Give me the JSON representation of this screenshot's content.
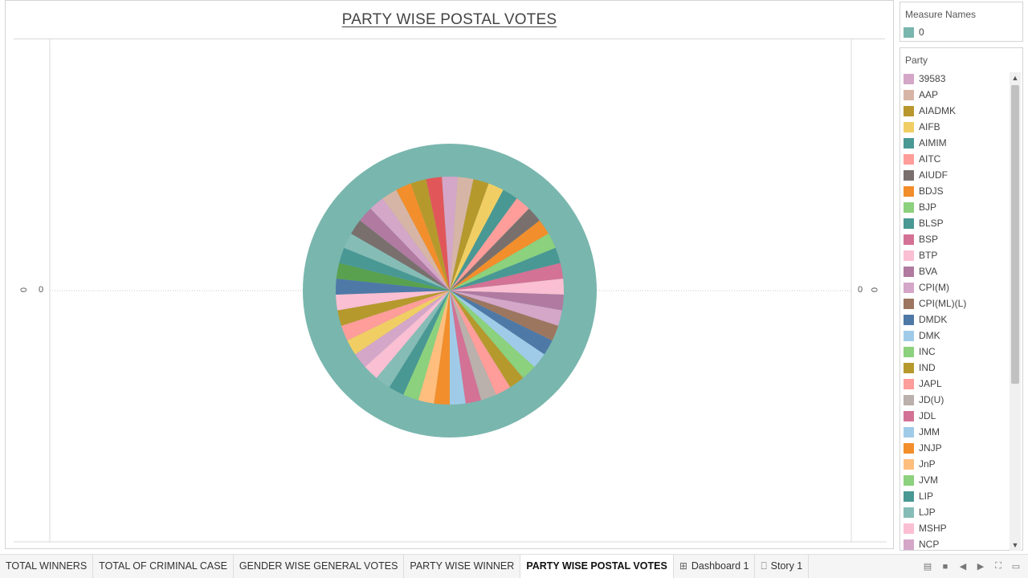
{
  "chart_data": {
    "type": "pie",
    "title": "PARTY WISE POSTAL VOTES",
    "axis_value_label": "0",
    "measure_legend_title": "Measure Names",
    "measure_names": [
      {
        "label": "0",
        "color": "#79b6ae"
      }
    ],
    "party_legend_title": "Party",
    "parties": [
      {
        "label": "39583",
        "color": "#d4a6c8"
      },
      {
        "label": "AAP",
        "color": "#d7b5a6"
      },
      {
        "label": "AIADMK",
        "color": "#b9972e"
      },
      {
        "label": "AIFB",
        "color": "#f1ce63"
      },
      {
        "label": "AIMIM",
        "color": "#499894"
      },
      {
        "label": "AITC",
        "color": "#ff9d9a"
      },
      {
        "label": "AIUDF",
        "color": "#79706e"
      },
      {
        "label": "BDJS",
        "color": "#f28e2b"
      },
      {
        "label": "BJP",
        "color": "#8cd17d"
      },
      {
        "label": "BLSP",
        "color": "#499894"
      },
      {
        "label": "BSP",
        "color": "#d37295"
      },
      {
        "label": "BTP",
        "color": "#fabfd2"
      },
      {
        "label": "BVA",
        "color": "#b07aa1"
      },
      {
        "label": "CPI(M)",
        "color": "#d4a6c8"
      },
      {
        "label": "CPI(ML)(L)",
        "color": "#9d7660"
      },
      {
        "label": "DMDK",
        "color": "#4e79a7"
      },
      {
        "label": "DMK",
        "color": "#a0cbe8"
      },
      {
        "label": "INC",
        "color": "#8cd17d"
      },
      {
        "label": "IND",
        "color": "#b6992d"
      },
      {
        "label": "JAPL",
        "color": "#ff9d9a"
      },
      {
        "label": "JD(U)",
        "color": "#bab0ac"
      },
      {
        "label": "JDL",
        "color": "#d37295"
      },
      {
        "label": "JMM",
        "color": "#a0cbe8"
      },
      {
        "label": "JNJP",
        "color": "#f28e2b"
      },
      {
        "label": "JnP",
        "color": "#ffbe7d"
      },
      {
        "label": "JVM",
        "color": "#8cd17d"
      },
      {
        "label": "LIP",
        "color": "#499894"
      },
      {
        "label": "LJP",
        "color": "#86bcb6"
      },
      {
        "label": "MSHP",
        "color": "#fabfd2"
      },
      {
        "label": "NCP",
        "color": "#d4a6c8"
      }
    ],
    "slice_colors": [
      "#d4a6c8",
      "#d7b5a6",
      "#b6992d",
      "#f1ce63",
      "#499894",
      "#ff9d9a",
      "#79706e",
      "#f28e2b",
      "#8cd17d",
      "#499894",
      "#d37295",
      "#fabfd2",
      "#b07aa1",
      "#d4a6c8",
      "#9d7660",
      "#4e79a7",
      "#a0cbe8",
      "#8cd17d",
      "#b6992d",
      "#ff9d9a",
      "#bab0ac",
      "#d37295",
      "#a0cbe8",
      "#f28e2b",
      "#ffbe7d",
      "#8cd17d",
      "#499894",
      "#86bcb6",
      "#fabfd2",
      "#d4a6c8",
      "#f1ce63",
      "#ff9d9a",
      "#b6992d",
      "#fabfd2",
      "#4e79a7",
      "#59a14f",
      "#499894",
      "#86bcb6",
      "#79706e",
      "#b07aa1",
      "#d4a6c8",
      "#d7b5a6",
      "#f28e2b",
      "#b6992d",
      "#e15759"
    ],
    "ring_color": "#79b6ae"
  },
  "tabs": [
    {
      "label": "TOTAL WINNERS",
      "icon": ""
    },
    {
      "label": "TOTAL OF CRIMINAL CASE",
      "icon": ""
    },
    {
      "label": "GENDER WISE GENERAL VOTES",
      "icon": ""
    },
    {
      "label": "PARTY WISE WINNER",
      "icon": ""
    },
    {
      "label": "PARTY WISE POSTAL VOTES",
      "icon": "",
      "active": true
    },
    {
      "label": "Dashboard 1",
      "icon": "dashboard-icon"
    },
    {
      "label": "Story 1",
      "icon": "story-icon"
    }
  ]
}
